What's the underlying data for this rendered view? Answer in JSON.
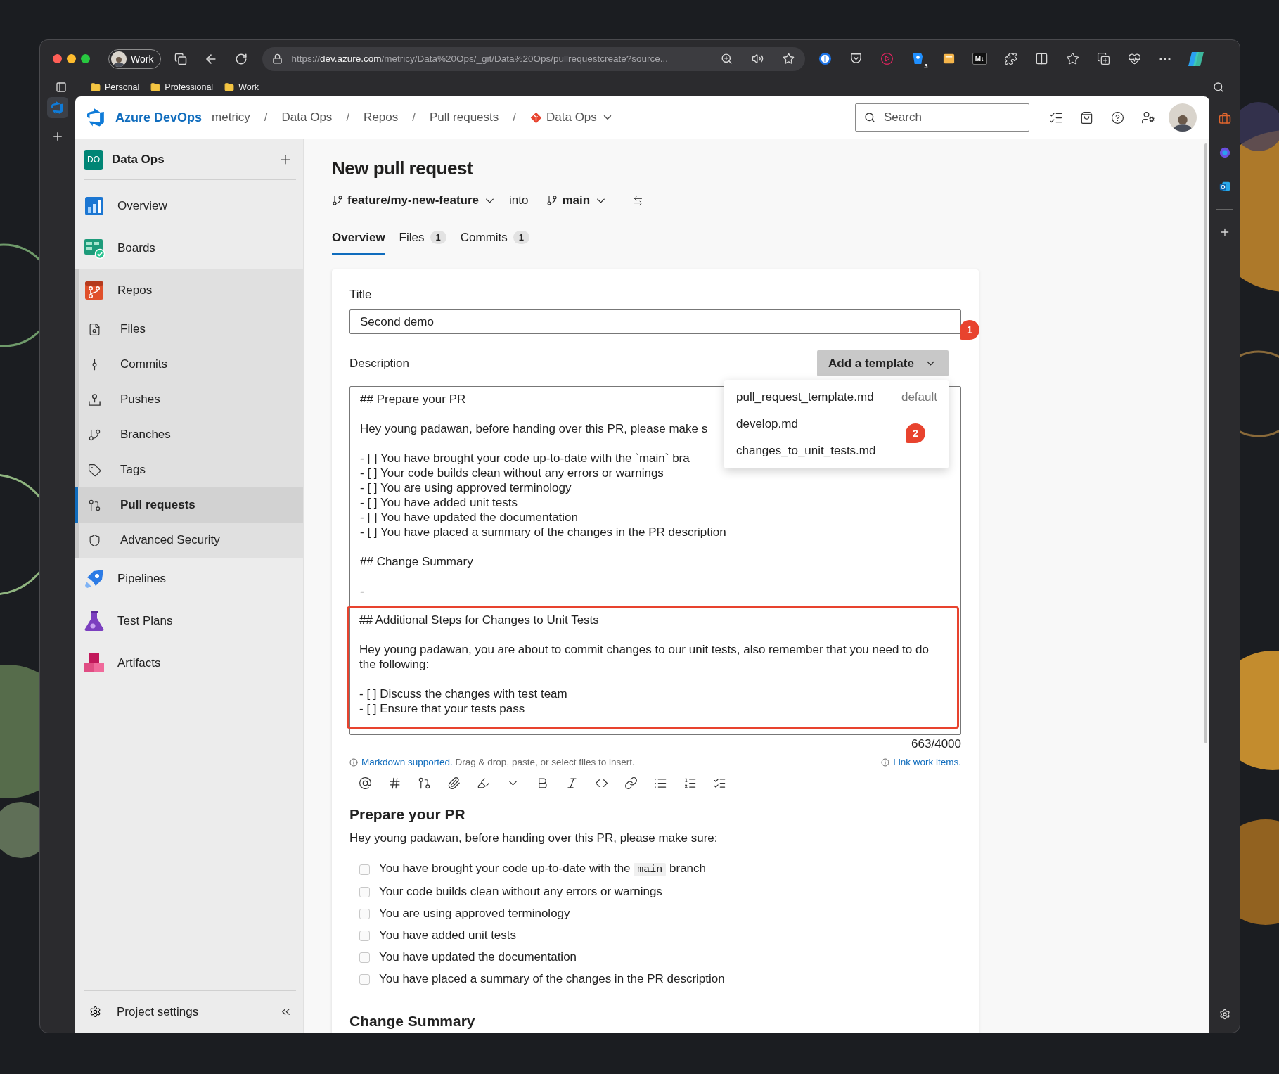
{
  "browser": {
    "profile": "Work",
    "url": {
      "scheme": "https://",
      "host": "dev.azure.com",
      "path": "/metricy/Data%20Ops/_git/Data%20Ops/pullrequestcreate?source..."
    },
    "extension_badge": "3",
    "markdown_badge": "M↓",
    "bookmarks": [
      "Personal",
      "Professional",
      "Work"
    ]
  },
  "header": {
    "brand": "Azure DevOps",
    "separator": "/",
    "breadcrumbs": [
      {
        "label": "metricy",
        "kind": "org"
      },
      {
        "label": "Data Ops",
        "kind": "page"
      },
      {
        "label": "Repos",
        "kind": "page"
      },
      {
        "label": "Pull requests",
        "kind": "page"
      },
      {
        "label": "Data Ops",
        "kind": "repo"
      }
    ],
    "search": {
      "placeholder": "Search"
    }
  },
  "sidebar": {
    "project": {
      "initials": "DO",
      "name": "Data Ops"
    },
    "items": [
      {
        "label": "Overview",
        "kind": "overview",
        "selected": false
      },
      {
        "label": "Boards",
        "kind": "boards",
        "selected": false
      },
      {
        "label": "Repos",
        "kind": "repos",
        "selected": false,
        "children": [
          {
            "label": "Files",
            "kind": "files",
            "selected": false
          },
          {
            "label": "Commits",
            "kind": "commits",
            "selected": false
          },
          {
            "label": "Pushes",
            "kind": "pushes",
            "selected": false
          },
          {
            "label": "Branches",
            "kind": "branches",
            "selected": false
          },
          {
            "label": "Tags",
            "kind": "tags",
            "selected": false
          },
          {
            "label": "Pull requests",
            "kind": "pullrequests",
            "selected": true
          },
          {
            "label": "Advanced Security",
            "kind": "security",
            "selected": false
          }
        ]
      },
      {
        "label": "Pipelines",
        "kind": "pipelines",
        "selected": false
      },
      {
        "label": "Test Plans",
        "kind": "testplans",
        "selected": false
      },
      {
        "label": "Artifacts",
        "kind": "artifacts",
        "selected": false
      }
    ],
    "footer": "Project settings"
  },
  "page": {
    "title": "New pull request",
    "source_branch": "feature/my-new-feature",
    "into": "into",
    "target_branch": "main",
    "tabs": [
      {
        "label": "Overview",
        "selected": true
      },
      {
        "label": "Files",
        "count": "1",
        "selected": false
      },
      {
        "label": "Commits",
        "count": "1",
        "selected": false
      }
    ]
  },
  "form": {
    "title_label": "Title",
    "title_value": "Second demo",
    "title_marker": "1",
    "description_label": "Description",
    "template_button": "Add a template",
    "menu_marker": "2",
    "template_menu": [
      {
        "label": "pull_request_template.md",
        "note": "default"
      },
      {
        "label": "develop.md"
      },
      {
        "label": "changes_to_unit_tests.md"
      }
    ],
    "description_sections": [
      {
        "highlighted": false,
        "blocks": [
          {
            "lines": [
              "## Prepare your PR"
            ]
          },
          {
            "lines": [
              "Hey young padawan, before handing over this PR, please make s"
            ]
          },
          {
            "lines": [
              "- [ ] You have brought your code up-to-date with the `main` bra",
              "- [ ] Your code builds clean without any errors or warnings",
              "- [ ] You are using approved terminology",
              "- [ ] You have added unit tests",
              "- [ ] You have updated the documentation",
              "- [ ] You have placed a summary of the changes in the PR description"
            ]
          },
          {
            "lines": [
              "## Change Summary"
            ]
          },
          {
            "lines": [
              "-"
            ]
          }
        ]
      },
      {
        "highlighted": true,
        "blocks": [
          {
            "lines": [
              "## Additional Steps for Changes to Unit Tests"
            ]
          },
          {
            "lines": [
              "Hey young padawan, you are about to commit changes to our unit tests, also remember that you need to do the following:"
            ]
          },
          {
            "lines": [
              "- [ ] Discuss the changes with test team",
              "- [ ] Ensure that your tests pass"
            ]
          }
        ]
      }
    ],
    "counter": "663/4000",
    "hint_link": "Markdown supported.",
    "hint_text": "Drag & drop, paste, or select files to insert.",
    "link_work_items": "Link work items."
  },
  "preview": {
    "heading": "Prepare your PR",
    "intro": "Hey young padawan, before handing over this PR, please make sure:",
    "checklist": [
      {
        "checked": false,
        "parts": [
          {
            "kind": "text",
            "text": "You have brought your code up-to-date with the "
          },
          {
            "kind": "code",
            "text": "main"
          },
          {
            "kind": "text",
            "text": " branch"
          }
        ]
      },
      {
        "checked": false,
        "parts": [
          {
            "kind": "text",
            "text": "Your code builds clean without any errors or warnings"
          }
        ]
      },
      {
        "checked": false,
        "parts": [
          {
            "kind": "text",
            "text": "You are using approved terminology"
          }
        ]
      },
      {
        "checked": false,
        "parts": [
          {
            "kind": "text",
            "text": "You have added unit tests"
          }
        ]
      },
      {
        "checked": false,
        "parts": [
          {
            "kind": "text",
            "text": "You have updated the documentation"
          }
        ]
      },
      {
        "checked": false,
        "parts": [
          {
            "kind": "text",
            "text": "You have placed a summary of the changes in the PR description"
          }
        ]
      }
    ],
    "heading_2": "Change Summary"
  }
}
